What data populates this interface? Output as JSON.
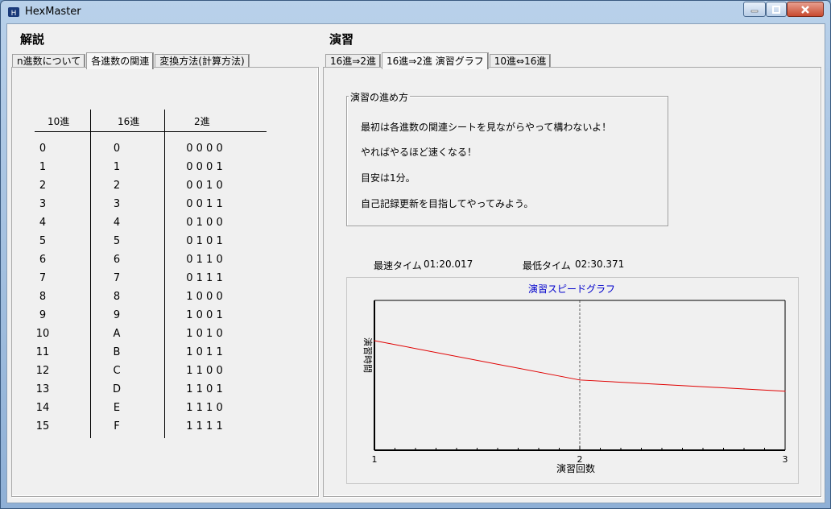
{
  "window": {
    "title": "HexMaster"
  },
  "left": {
    "heading": "解説",
    "tabs": [
      {
        "label": "n進数について",
        "active": false
      },
      {
        "label": "各進数の関連",
        "active": true
      },
      {
        "label": "変換方法(計算方法)",
        "active": false
      }
    ],
    "table": {
      "headers": [
        "10進",
        "16進",
        "2進"
      ],
      "rows": [
        [
          "0",
          "0",
          "0 0 0 0"
        ],
        [
          "1",
          "1",
          "0 0 0 1"
        ],
        [
          "2",
          "2",
          "0 0 1 0"
        ],
        [
          "3",
          "3",
          "0 0 1 1"
        ],
        [
          "4",
          "4",
          "0 1 0 0"
        ],
        [
          "5",
          "5",
          "0 1 0 1"
        ],
        [
          "6",
          "6",
          "0 1 1 0"
        ],
        [
          "7",
          "7",
          "0 1 1 1"
        ],
        [
          "8",
          "8",
          "1 0 0 0"
        ],
        [
          "9",
          "9",
          "1 0 0 1"
        ],
        [
          "10",
          "A",
          "1 0 1 0"
        ],
        [
          "11",
          "B",
          "1 0 1 1"
        ],
        [
          "12",
          "C",
          "1 1 0 0"
        ],
        [
          "13",
          "D",
          "1 1 0 1"
        ],
        [
          "14",
          "E",
          "1 1 1 0"
        ],
        [
          "15",
          "F",
          "1 1 1 1"
        ]
      ]
    }
  },
  "right": {
    "heading": "演習",
    "tabs": [
      {
        "label": "16進⇒2進",
        "active": false
      },
      {
        "label": "16進⇒2進  演習グラフ",
        "active": true
      },
      {
        "label": "10進⇔16進",
        "active": false
      }
    ],
    "guide": {
      "title": "演習の進め方",
      "lines": [
        "最初は各進数の関連シートを見ながらやって構わないよ！",
        "やればやるほど速くなる！",
        "目安は1分。",
        "自己記録更新を目指してやってみよう。"
      ]
    },
    "stats": {
      "fastest_label": "最速タイム",
      "fastest_value": "01:20.017",
      "slowest_label": "最低タイム",
      "slowest_value": "02:30.371"
    }
  },
  "colors": {
    "line": "#e00000",
    "chart_title": "#0000cc"
  },
  "chart_data": {
    "type": "line",
    "title": "演習スピードグラフ",
    "xlabel": "演習回数",
    "ylabel": "演習時間",
    "x": [
      1,
      2,
      3
    ],
    "xlim": [
      1,
      3
    ],
    "ylim": [
      0,
      160
    ],
    "grid": "vertical-dashed",
    "series": [
      {
        "values": [
          117,
          75,
          63
        ]
      }
    ]
  }
}
